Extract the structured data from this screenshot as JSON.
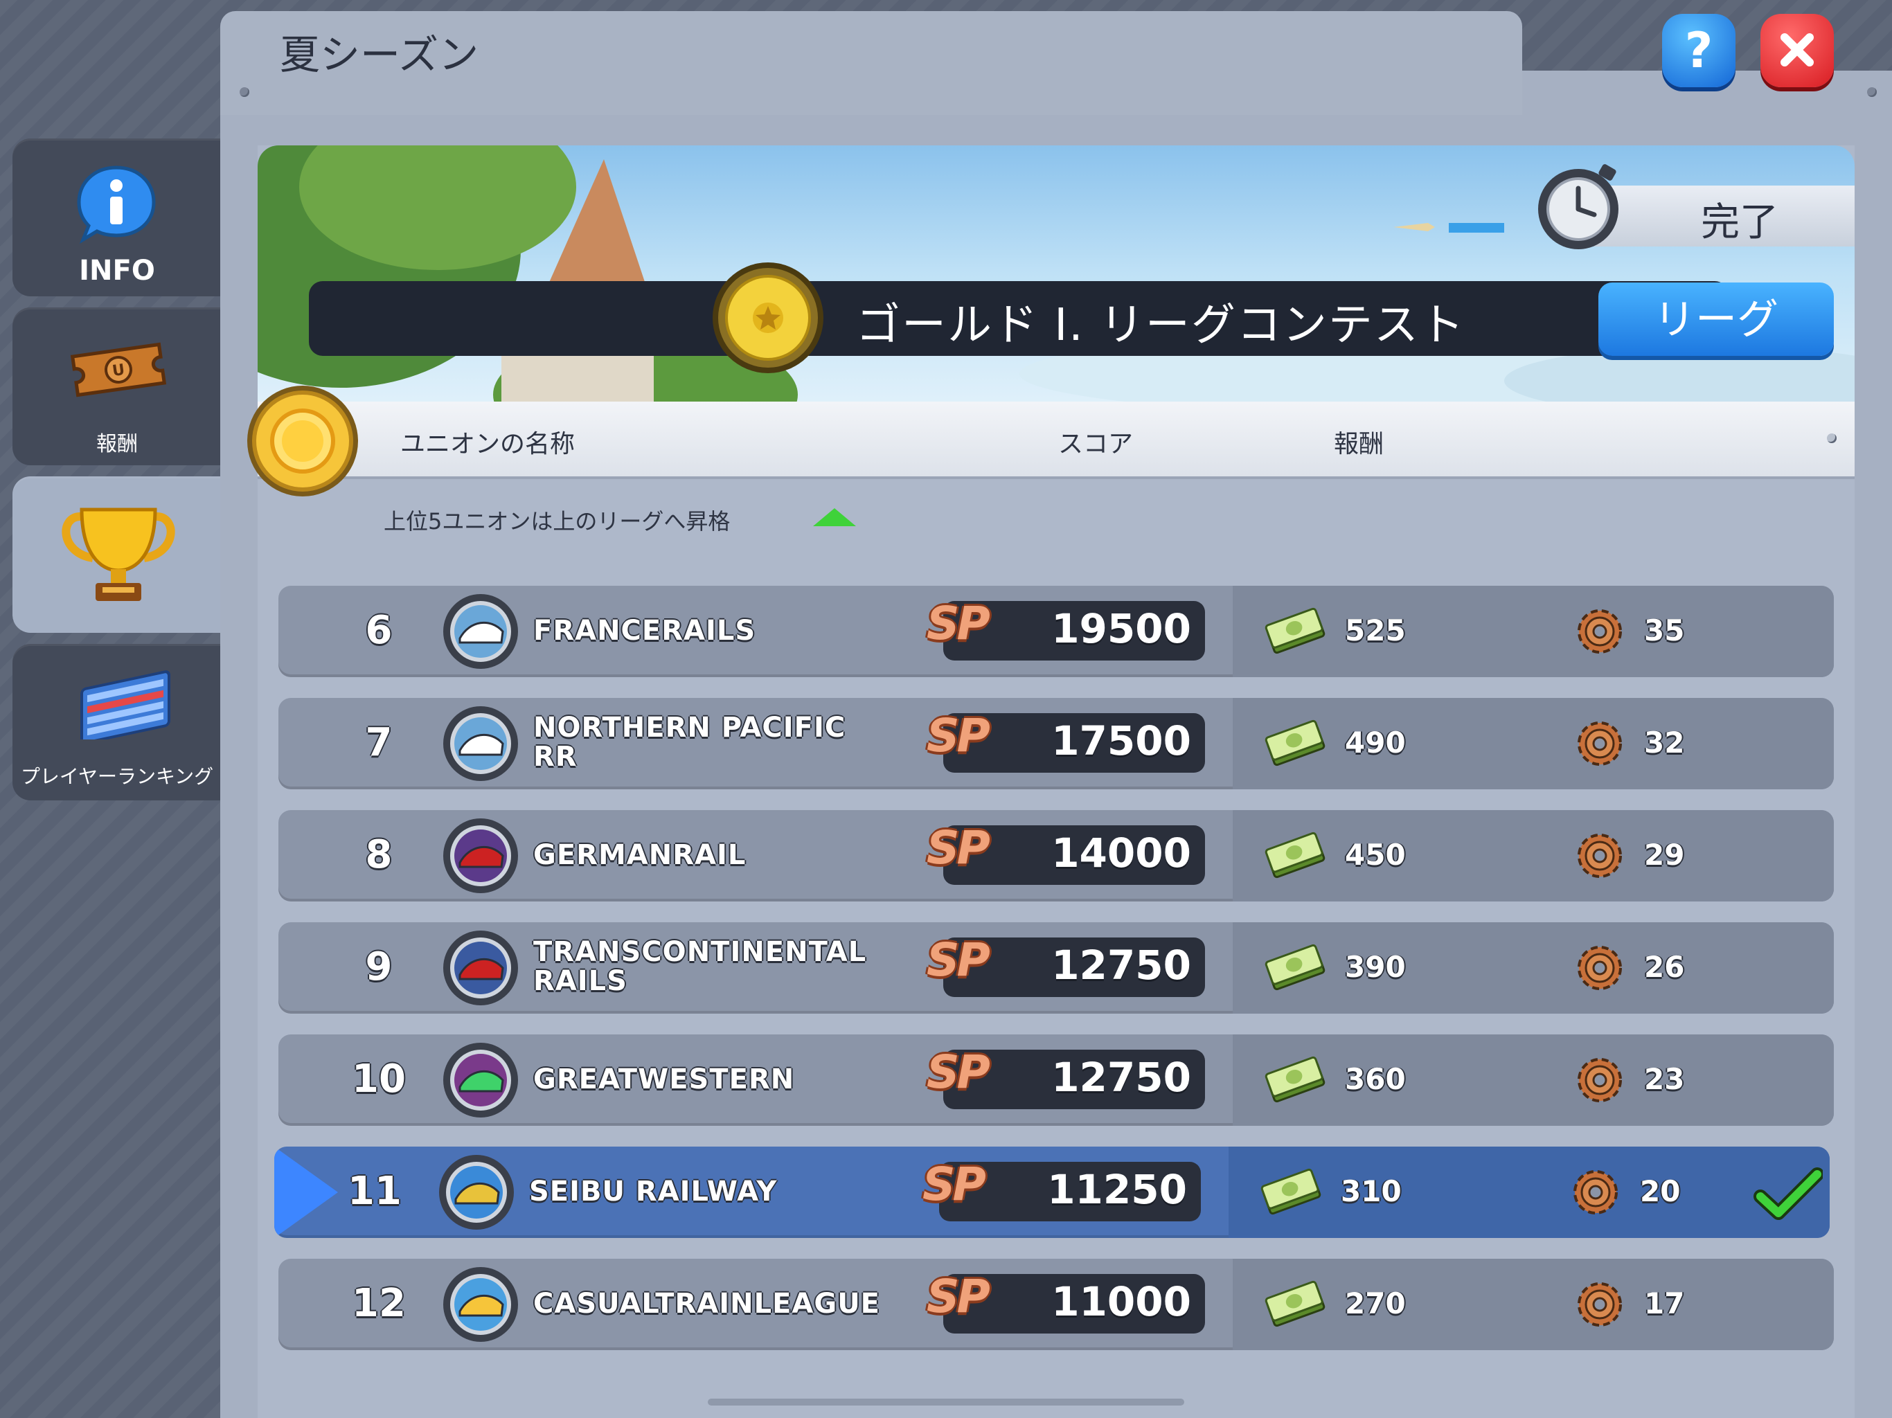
{
  "window": {
    "title": "夏シーズン"
  },
  "sidebar": {
    "items": [
      {
        "label": "INFO",
        "icon": "info-icon"
      },
      {
        "label": "報酬",
        "icon": "ticket-icon"
      },
      {
        "label": "",
        "icon": "trophy-icon",
        "active": true
      },
      {
        "label": "プレイヤーランキング",
        "icon": "ranking-board-icon"
      }
    ]
  },
  "contest": {
    "name": "ゴールド Ⅰ. リーグコンテスト",
    "league_button": "リーグ",
    "status": "完了"
  },
  "table": {
    "headers": {
      "union": "ユニオンの名称",
      "score": "スコア",
      "reward": "報酬"
    },
    "promotion_note": "上位5ユニオンは上のリーグへ昇格",
    "score_badge": "SP",
    "rows": [
      {
        "rank": "6",
        "name": "FRANCERAILS",
        "score": "19500",
        "cash": "525",
        "gears": "35"
      },
      {
        "rank": "7",
        "name": "NORTHERN PACIFIC RR",
        "score": "17500",
        "cash": "490",
        "gears": "32"
      },
      {
        "rank": "8",
        "name": "GERMANRAIL",
        "score": "14000",
        "cash": "450",
        "gears": "29"
      },
      {
        "rank": "9",
        "name": "TRANSCONTINENTAL RAILS",
        "score": "12750",
        "cash": "390",
        "gears": "26"
      },
      {
        "rank": "10",
        "name": "GREATWESTERN",
        "score": "12750",
        "cash": "360",
        "gears": "23"
      },
      {
        "rank": "11",
        "name": "SEIBU RAILWAY",
        "score": "11250",
        "cash": "310",
        "gears": "20",
        "highlight": true
      },
      {
        "rank": "12",
        "name": "CASUALTRAINLEAGUE",
        "score": "11000",
        "cash": "270",
        "gears": "17"
      }
    ]
  },
  "colors": {
    "highlight_row": "#4b72b6",
    "league_button": "#1d78e0",
    "close_button": "#e8262c",
    "help_button": "#1a7fe0"
  }
}
